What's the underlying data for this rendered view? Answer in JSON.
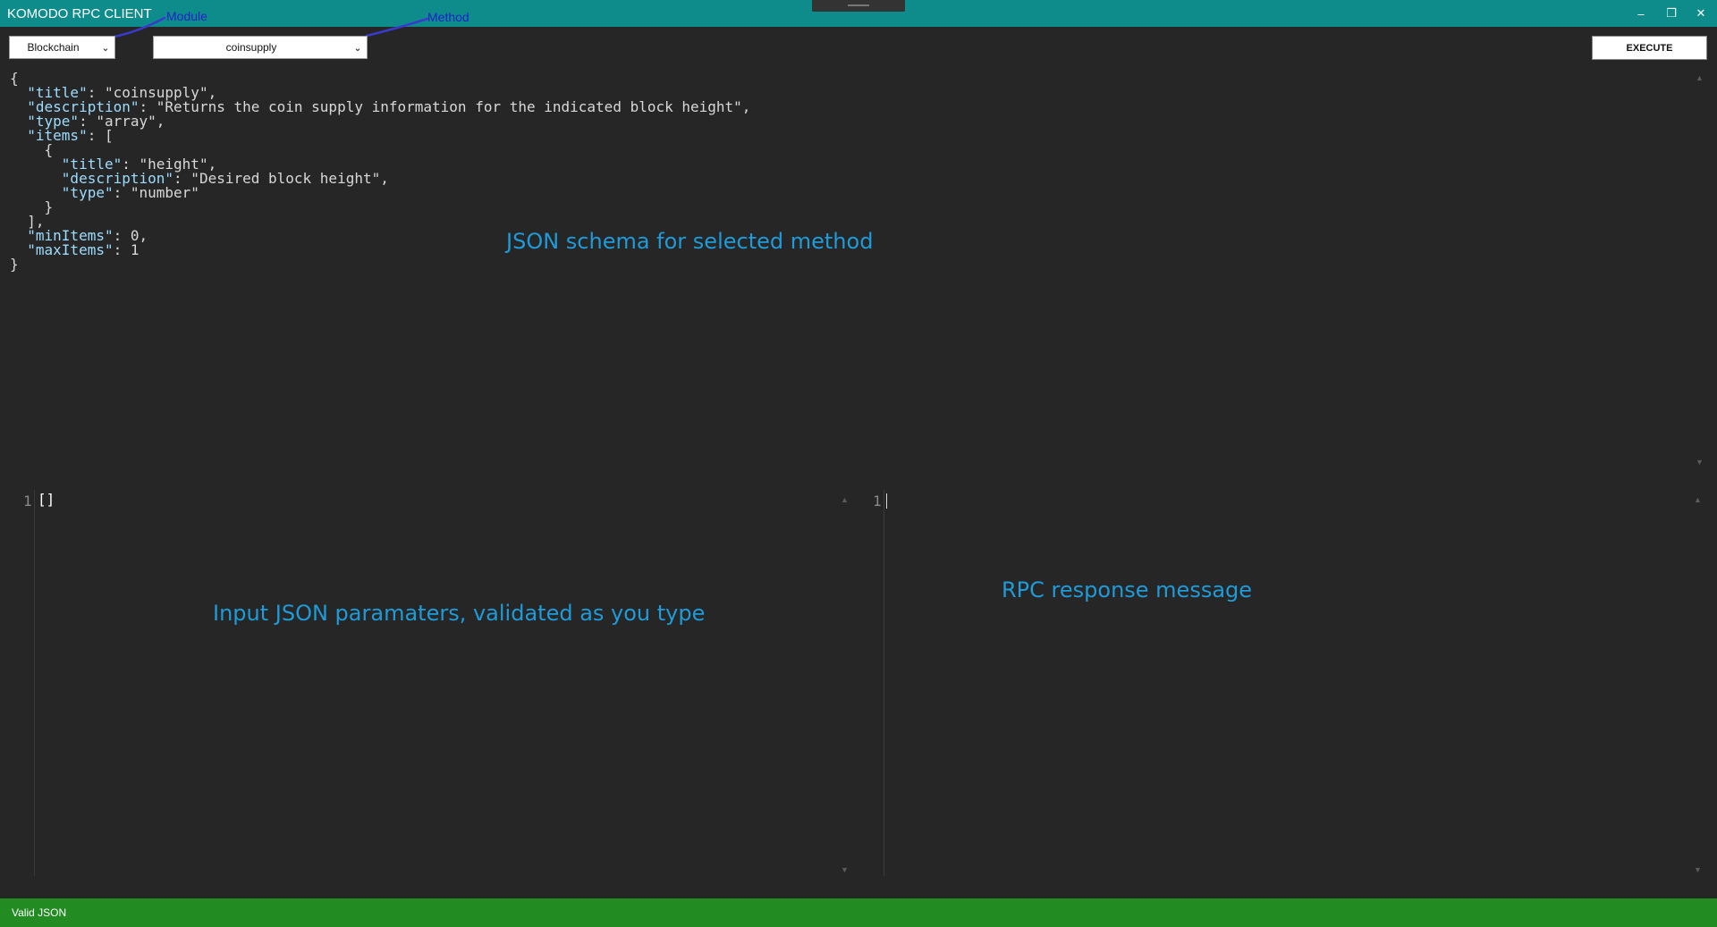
{
  "window": {
    "title": "KOMODO RPC CLIENT",
    "controls": {
      "minimize": "‒",
      "restore": "❐",
      "close": "✕"
    }
  },
  "annotations": {
    "module": "Module",
    "method": "Method",
    "schema": "JSON schema for selected method",
    "input": "Input JSON paramaters, validated as you type",
    "response": "RPC response message"
  },
  "toolbar": {
    "module_select": {
      "value": "Blockchain"
    },
    "method_select": {
      "value": "coinsupply"
    },
    "execute_label": "EXECUTE"
  },
  "schema": {
    "lines": [
      "{",
      "  \"title\": \"coinsupply\",",
      "  \"description\": \"Returns the coin supply information for the indicated block height\",",
      "  \"type\": \"array\",",
      "  \"items\": [",
      "    {",
      "      \"title\": \"height\",",
      "      \"description\": \"Desired block height\",",
      "      \"type\": \"number\"",
      "    }",
      "  ],",
      "  \"minItems\": 0,",
      "  \"maxItems\": 1",
      "}"
    ]
  },
  "input_editor": {
    "line_number": "1",
    "content": "[]"
  },
  "response_editor": {
    "line_number": "1",
    "content": ""
  },
  "status": {
    "text": "Valid JSON",
    "color": "#228b22"
  },
  "colors": {
    "titlebar": "#0e8c8c",
    "background": "#262626",
    "annotation_blue": "#1e22c8",
    "overlay_label": "#1e9bd8"
  }
}
